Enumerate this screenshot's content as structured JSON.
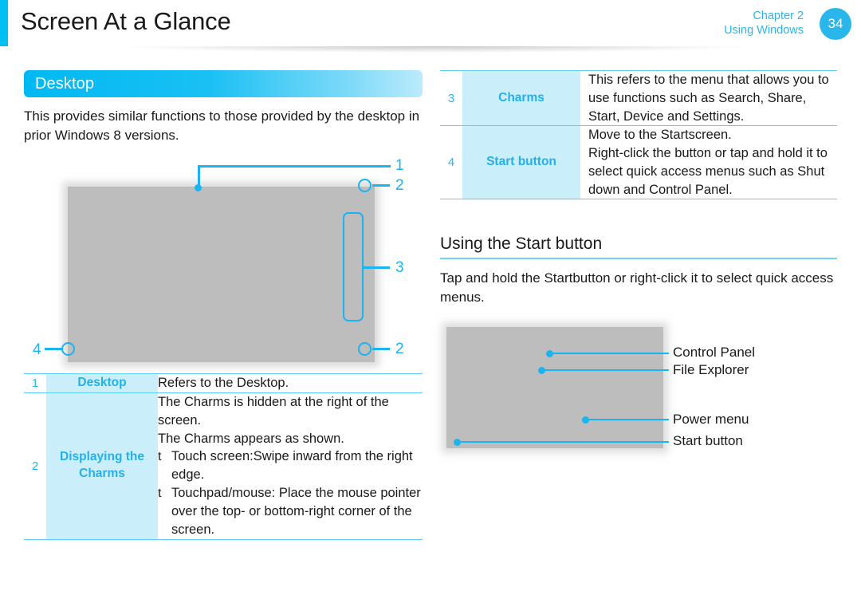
{
  "header": {
    "title": "Screen At a Glance",
    "chapter_line1": "Chapter 2",
    "chapter_line2": "Using Windows",
    "page_number": "34",
    "accent_color": "#00BFF3",
    "badge_color": "#29B6EA"
  },
  "left": {
    "section": {
      "title": "Desktop",
      "paragraph": "This provides similar functions to those provided by the desktop in prior Windows 8 versions."
    },
    "diagram": {
      "name": "desktop-screen-diagram",
      "callouts": [
        {
          "number": "1",
          "marker": "dot"
        },
        {
          "number": "2",
          "marker": "circle"
        },
        {
          "number": "3",
          "marker": "bar"
        },
        {
          "number": "4",
          "marker": "circle"
        },
        {
          "number": "2",
          "marker": "circle"
        }
      ]
    },
    "table": {
      "rows": [
        {
          "number": "1",
          "label": "Desktop",
          "lines": [
            {
              "type": "text",
              "text": "Refers to the Desktop."
            }
          ]
        },
        {
          "number": "2",
          "label": "Displaying the Charms",
          "label_line1": "Displaying the",
          "label_line2": "Charms",
          "lines": [
            {
              "type": "text",
              "text": "The Charms is hidden at the right of the screen."
            },
            {
              "type": "text",
              "text": "The Charms appears as shown."
            },
            {
              "type": "bullet",
              "glyph": "t",
              "text": "Touch screen:Swipe inward from the right edge."
            },
            {
              "type": "bullet",
              "glyph": "t",
              "text": "Touchpad/mouse: Place the mouse pointer over the top- or bottom-right corner of the screen."
            }
          ]
        }
      ]
    }
  },
  "right": {
    "table": {
      "rows": [
        {
          "number": "3",
          "label": "Charms",
          "lines": [
            {
              "type": "text",
              "text": "This refers to the menu that allows you to use functions such as Search, Share, Start, Device and Settings."
            }
          ]
        },
        {
          "number": "4",
          "label": "Start button",
          "lines": [
            {
              "type": "text",
              "text": "Move to the Startscreen."
            },
            {
              "type": "text",
              "text": "Right-click the button or tap and hold it to select quick access menus such as Shut down and Control Panel."
            }
          ]
        }
      ]
    },
    "subsection": {
      "title": "Using the Start button",
      "paragraph": "Tap and hold the Startbutton  or right-click it to select quick access menus."
    },
    "diagram": {
      "name": "start-button-menu-diagram",
      "labels": [
        {
          "text": "Control Panel"
        },
        {
          "text": "File Explorer"
        },
        {
          "text": "Power menu"
        },
        {
          "text": "Start button"
        }
      ]
    }
  },
  "colors": {
    "cyan": "#1BB4F0",
    "light_cyan_cell": "#CBEEFB",
    "rule": "#5ECEF4",
    "screen_gray": "#BDBDBD"
  }
}
